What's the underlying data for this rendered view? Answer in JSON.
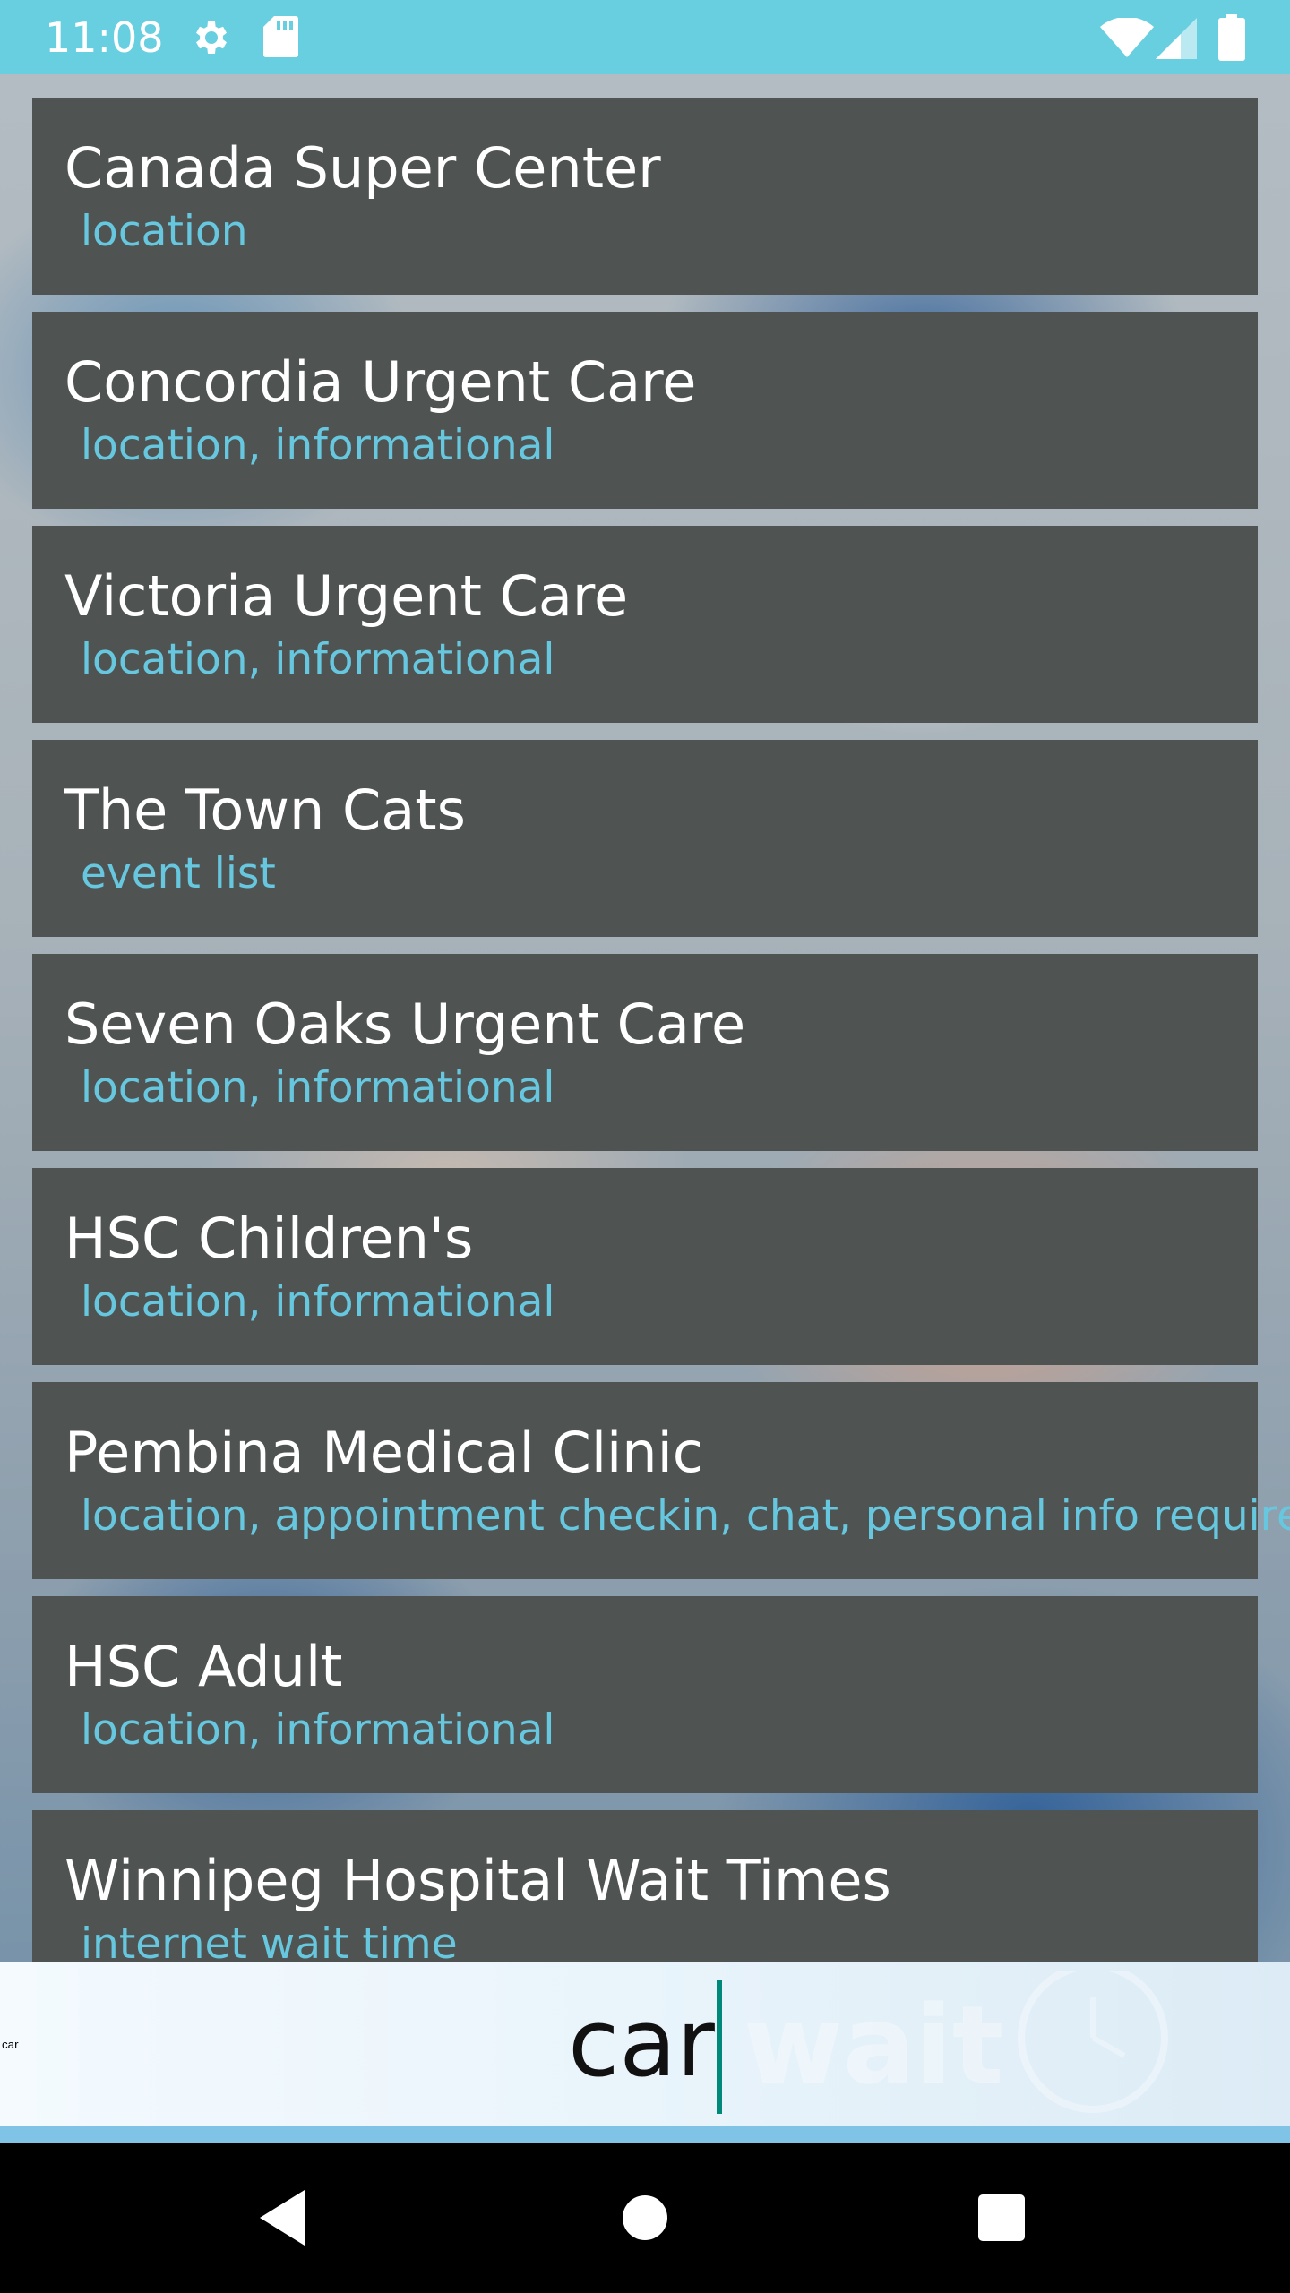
{
  "status_bar": {
    "time": "11:08",
    "left_icons": [
      "settings-gear-icon",
      "sd-card-icon"
    ],
    "right_icons": [
      "wifi-icon",
      "cell-signal-icon",
      "battery-icon"
    ],
    "color": "#67cfdf"
  },
  "list": {
    "items": [
      {
        "title": "Canada Super Center",
        "tags": "location"
      },
      {
        "title": "Concordia Urgent Care",
        "tags": "location, informational"
      },
      {
        "title": "Victoria Urgent Care",
        "tags": "location, informational"
      },
      {
        "title": "The Town Cats",
        "tags": "event list"
      },
      {
        "title": "Seven Oaks Urgent Care",
        "tags": "location, informational"
      },
      {
        "title": "HSC Children's",
        "tags": "location, informational"
      },
      {
        "title": "Pembina Medical Clinic",
        "tags": "location, appointment checkin, chat, personal info required"
      },
      {
        "title": "HSC Adult",
        "tags": "location, informational"
      },
      {
        "title": "Winnipeg Hospital Wait Times",
        "tags": "internet wait time"
      }
    ],
    "card_color": "#4f5352",
    "title_color": "#ffffff",
    "tag_color": "#66c7df"
  },
  "search": {
    "value": "car",
    "watermark": "wait",
    "caret_color": "#00897b"
  },
  "nav_bar": {
    "buttons": [
      "back-icon",
      "home-icon",
      "recents-icon"
    ]
  }
}
